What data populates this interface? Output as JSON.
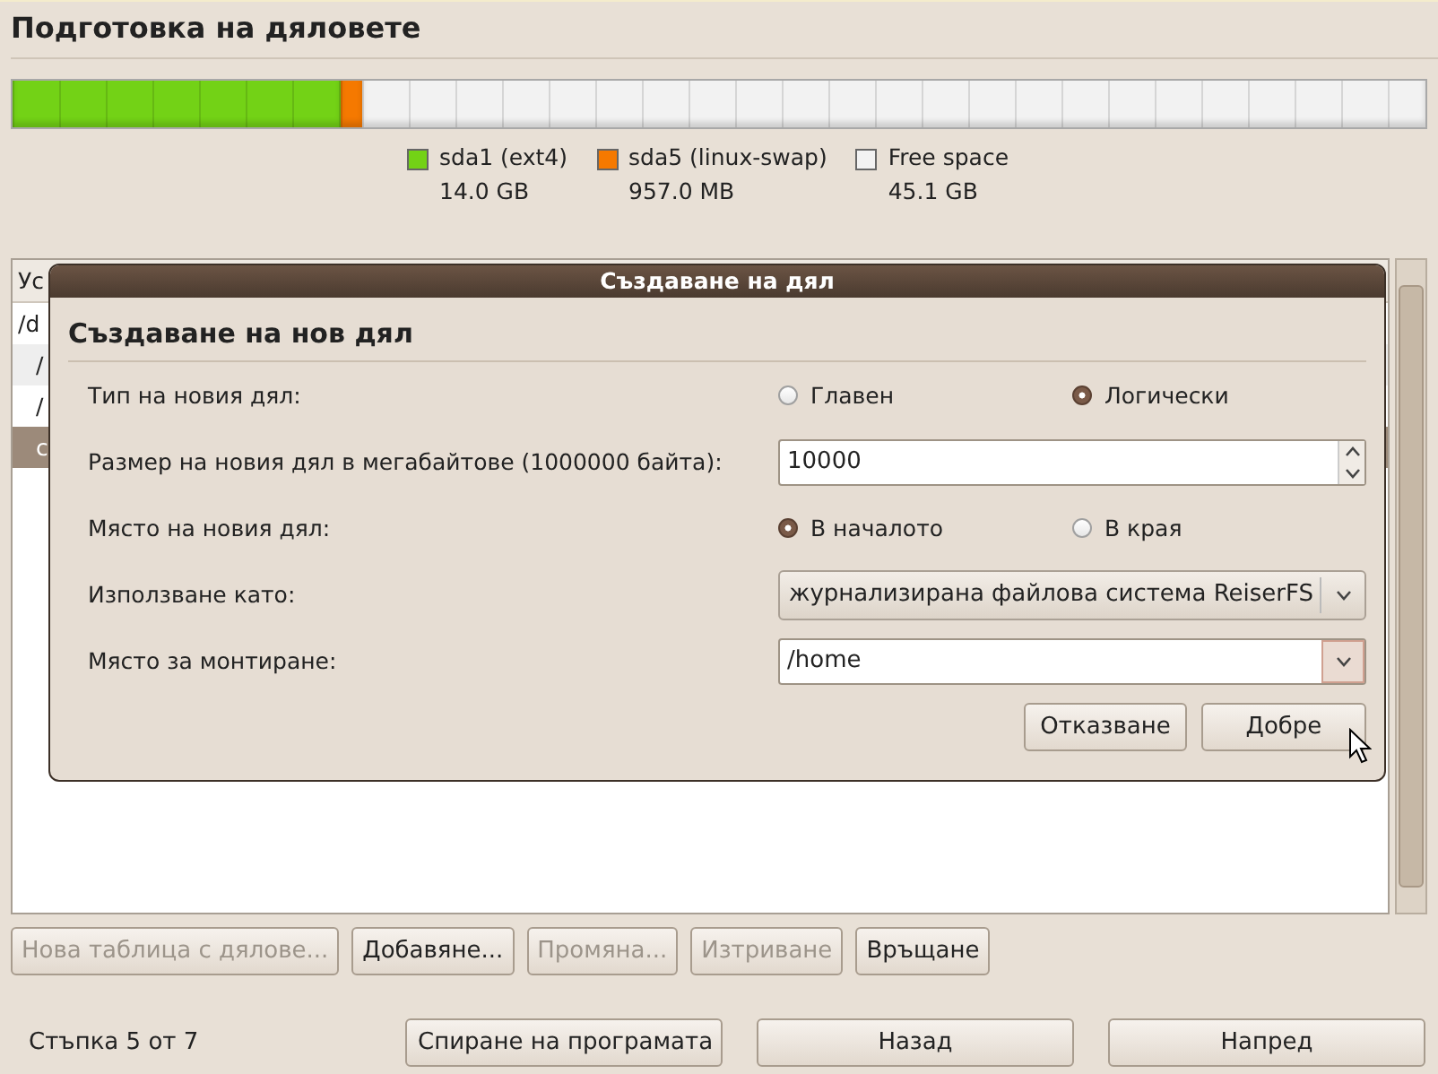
{
  "title": "Подготовка на дяловете",
  "partitions": [
    {
      "name": "sda1 (ext4)",
      "size": "14.0 GB",
      "color": "#73d216",
      "level": 0.232
    },
    {
      "name": "sda5 (linux-swap)",
      "size": "957.0 MB",
      "color": "#f57900",
      "level": 0.016
    },
    {
      "name": "Free space",
      "size": "45.1 GB",
      "color": "#f2f2f2",
      "level": 0.752
    }
  ],
  "table": {
    "header": "Ус",
    "rows": [
      {
        "text": "/d",
        "selected": false
      },
      {
        "text": "/",
        "selected": false
      },
      {
        "text": "/",
        "selected": false
      },
      {
        "text": "с",
        "selected": true
      }
    ]
  },
  "dialog": {
    "title": "Създаване на дял",
    "heading": "Създаване на нов дял",
    "rows": [
      {
        "kind": "radio",
        "label": "Тип на новия дял:",
        "options": [
          {
            "label": "Главен",
            "selected": false
          },
          {
            "label": "Логически",
            "selected": true
          }
        ]
      },
      {
        "kind": "spin",
        "label": "Размер на новия дял в мегабайтове (1000000 байта):",
        "value": "10000"
      },
      {
        "kind": "radio",
        "label": "Място на новия дял:",
        "options": [
          {
            "label": "В началото",
            "selected": true
          },
          {
            "label": "В края",
            "selected": false
          }
        ]
      },
      {
        "kind": "select",
        "label": "Използване като:",
        "value": "журнализирана файлова система ReiserFS"
      },
      {
        "kind": "combo",
        "label": "Място за монтиране:",
        "value": "/home"
      }
    ],
    "buttons": [
      "Отказване",
      "Добре"
    ]
  },
  "actions": [
    {
      "label": "Нова таблица с дялове...",
      "disabled": true
    },
    {
      "label": "Добавяне...",
      "disabled": false
    },
    {
      "label": "Промяна...",
      "disabled": true
    },
    {
      "label": "Изтриване",
      "disabled": true
    },
    {
      "label": "Връщане",
      "disabled": false
    }
  ],
  "step": "Стъпка 5 от 7",
  "nav": [
    "Спиране на програмата",
    "Назад",
    "Напред"
  ]
}
